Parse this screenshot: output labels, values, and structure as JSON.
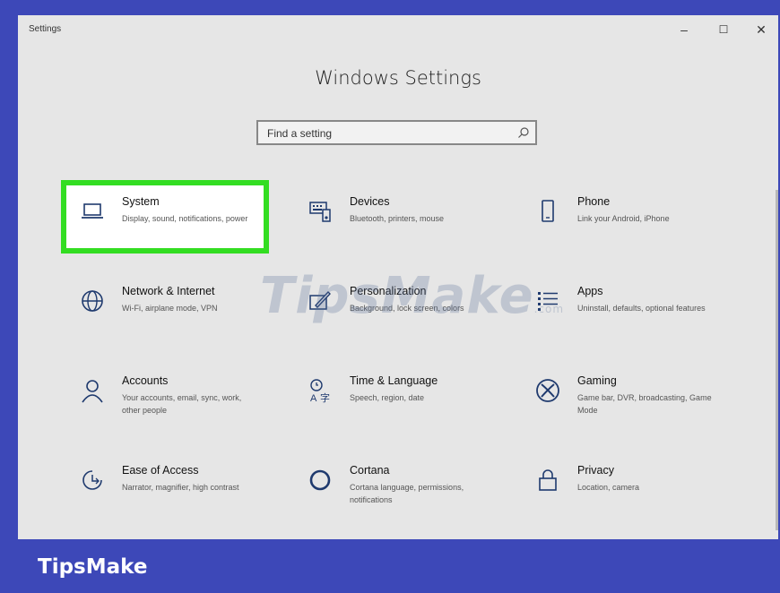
{
  "window": {
    "title": "Settings",
    "minimize": "–",
    "maximize": "☐",
    "close": "✕"
  },
  "heading": "Windows Settings",
  "search": {
    "placeholder": "Find a setting"
  },
  "tiles": [
    {
      "title": "System",
      "desc": "Display, sound, notifications, power",
      "icon": "laptop-icon",
      "highlighted": true
    },
    {
      "title": "Devices",
      "desc": "Bluetooth, printers, mouse",
      "icon": "keyboard-icon"
    },
    {
      "title": "Phone",
      "desc": "Link your Android, iPhone",
      "icon": "phone-icon"
    },
    {
      "title": "Network & Internet",
      "desc": "Wi-Fi, airplane mode, VPN",
      "icon": "globe-icon"
    },
    {
      "title": "Personalization",
      "desc": "Background, lock screen, colors",
      "icon": "paintbrush-icon"
    },
    {
      "title": "Apps",
      "desc": "Uninstall, defaults, optional features",
      "icon": "apps-list-icon"
    },
    {
      "title": "Accounts",
      "desc": "Your accounts, email, sync, work, other people",
      "icon": "person-icon"
    },
    {
      "title": "Time & Language",
      "desc": "Speech, region, date",
      "icon": "time-language-icon"
    },
    {
      "title": "Gaming",
      "desc": "Game bar, DVR, broadcasting, Game Mode",
      "icon": "xbox-icon"
    },
    {
      "title": "Ease of Access",
      "desc": "Narrator, magnifier, high contrast",
      "icon": "ease-of-access-icon"
    },
    {
      "title": "Cortana",
      "desc": "Cortana language, permissions, notifications",
      "icon": "cortana-icon"
    },
    {
      "title": "Privacy",
      "desc": "Location, camera",
      "icon": "lock-icon"
    }
  ],
  "watermark": {
    "text": "TipsMake",
    "suffix": ".com"
  },
  "brand": "TipsMake",
  "colors": {
    "highlight": "#33dd22",
    "brand_bar": "#3d48b8",
    "icon": "#1f3a6e"
  }
}
